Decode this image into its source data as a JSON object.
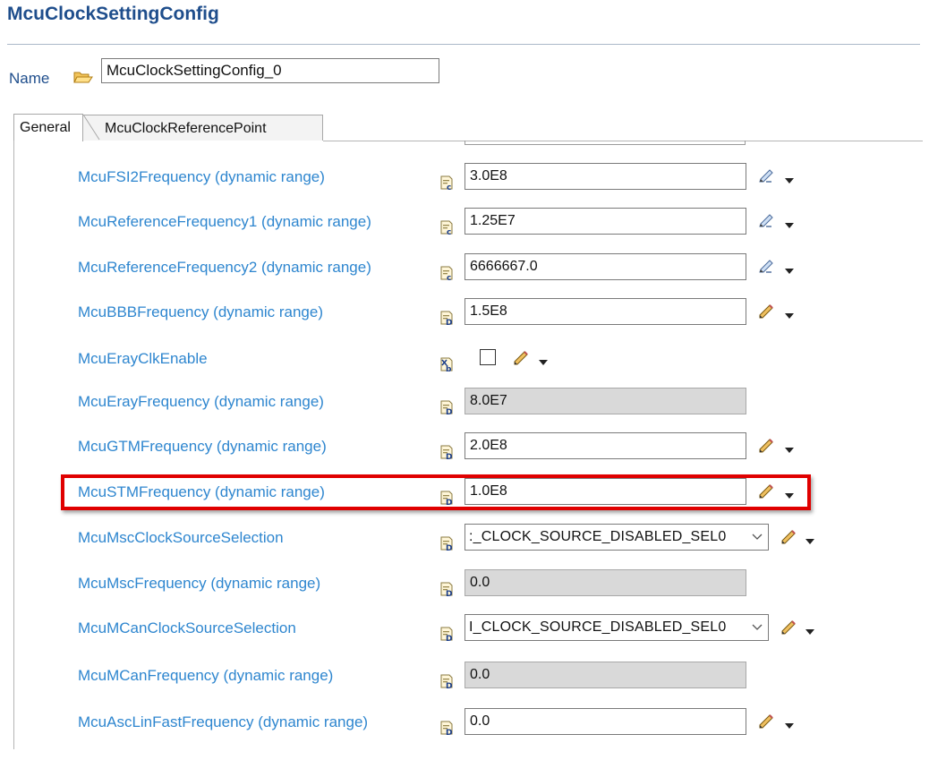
{
  "page": {
    "title": "McuClockSettingConfig"
  },
  "name_row": {
    "label": "Name",
    "value": "McuClockSettingConfig_0"
  },
  "tabs": [
    {
      "label": "General",
      "active": true
    },
    {
      "label": "McuClockReferencePoint",
      "active": false
    }
  ],
  "colors": {
    "title": "#1f4e8c",
    "param_label": "#2e86cf",
    "highlight": "#e00000",
    "disabled_field": "#d9d9d9"
  },
  "rows": [
    {
      "label": "McuFSI2Frequency (dynamic range)",
      "value": "3.0E8",
      "kind": "text",
      "icon": "calc-param-icon",
      "edit_icon": "edit-calc-icon"
    },
    {
      "label": "McuReferenceFrequency1 (dynamic range)",
      "value": "1.25E7",
      "kind": "text",
      "icon": "calc-param-icon",
      "edit_icon": "edit-calc-icon"
    },
    {
      "label": "McuReferenceFrequency2 (dynamic range)",
      "value": "6666667.0",
      "kind": "text",
      "icon": "calc-param-icon",
      "edit_icon": "edit-calc-icon"
    },
    {
      "label": "McuBBBFrequency (dynamic range)",
      "value": "1.5E8",
      "kind": "text",
      "icon": "float-param-icon",
      "edit_icon": "pencil-icon"
    },
    {
      "label": "McuErayClkEnable",
      "value": "",
      "kind": "checkbox",
      "icon": "bool-param-icon",
      "edit_icon": "pencil-icon"
    },
    {
      "label": "McuErayFrequency (dynamic range)",
      "value": "8.0E7",
      "kind": "disabled",
      "icon": "float-param-icon"
    },
    {
      "label": "McuGTMFrequency (dynamic range)",
      "value": "2.0E8",
      "kind": "text",
      "icon": "float-param-icon",
      "edit_icon": "pencil-icon"
    },
    {
      "label": "McuSTMFrequency (dynamic range)",
      "value": "1.0E8",
      "kind": "text",
      "icon": "float-param-icon",
      "edit_icon": "pencil-icon",
      "highlighted": true
    },
    {
      "label": "McuMscClockSourceSelection",
      "value": ":_CLOCK_SOURCE_DISABLED_SEL0",
      "kind": "select",
      "icon": "float-param-icon",
      "edit_icon": "pencil-icon"
    },
    {
      "label": "McuMscFrequency (dynamic range)",
      "value": "0.0",
      "kind": "disabled",
      "icon": "float-param-icon"
    },
    {
      "label": "McuMCanClockSourceSelection",
      "value": "I_CLOCK_SOURCE_DISABLED_SEL0",
      "kind": "select",
      "icon": "float-param-icon",
      "edit_icon": "pencil-icon"
    },
    {
      "label": "McuMCanFrequency (dynamic range)",
      "value": "0.0",
      "kind": "disabled",
      "icon": "float-param-icon"
    },
    {
      "label": "McuAscLinFastFrequency (dynamic range)",
      "value": "0.0",
      "kind": "text",
      "icon": "float-param-icon",
      "edit_icon": "pencil-icon"
    }
  ]
}
